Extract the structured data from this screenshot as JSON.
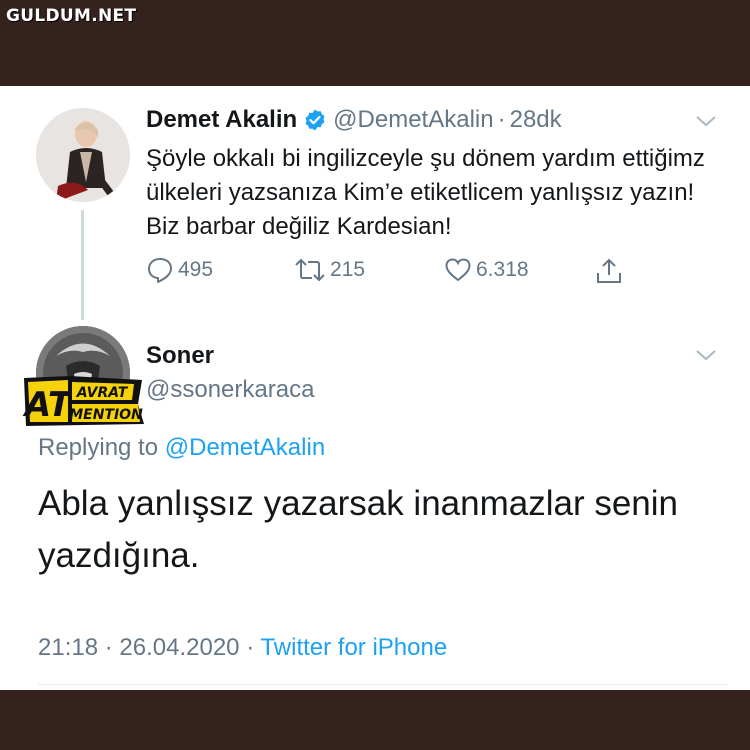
{
  "watermark": "GULDUM.NET",
  "tweet": {
    "name": "Demet Akalin",
    "handle": "@DemetAkalin",
    "separator": "·",
    "time": "28dk",
    "text": "Şöyle okkalı bi ingilizceyle şu dönem yardım ettiğimz ülkeleri yazsanıza Kim’e etiketlicem yanlışsız yazın! Biz barbar değiliz Kardesian!",
    "replies": "495",
    "retweets": "215",
    "likes": "6.318"
  },
  "reply": {
    "name": "Soner",
    "handle": "@ssonerkaraca",
    "replying_label": "Replying to",
    "replying_to": "@DemetAkalin",
    "text": "Abla yanlışsız yazarsak inanmazlar senin yazdığına.",
    "time": "21:18",
    "separator": "·",
    "date": "26.04.2020",
    "source": "Twitter for iPhone"
  },
  "sticker": {
    "big": "AT",
    "top": "AVRAT",
    "bottom": "MENTION"
  },
  "colors": {
    "frame": "#35211d",
    "text": "#14171a",
    "secondary": "#657786",
    "link": "#1da1f2",
    "sticker_yellow": "#f5d20a"
  },
  "icons": {
    "verified": "verified-badge-icon",
    "caret": "chevron-down-icon",
    "reply": "reply-bubble-icon",
    "retweet": "retweet-icon",
    "like": "heart-icon",
    "share": "share-icon"
  }
}
